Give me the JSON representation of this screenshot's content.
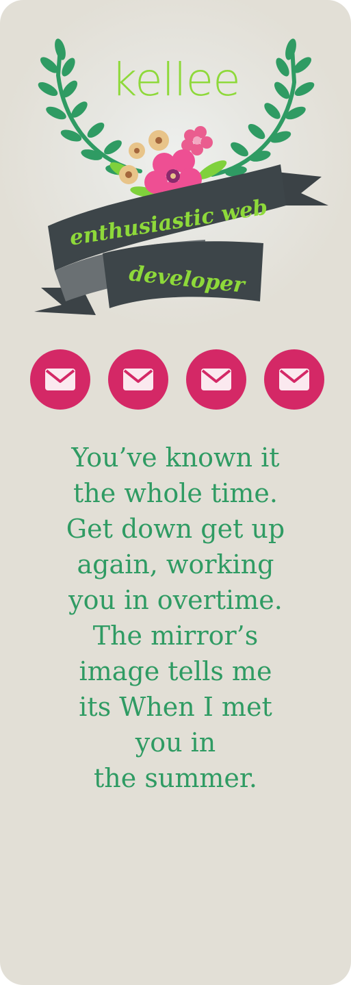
{
  "header": {
    "site_name": "kellee",
    "tagline_line1": "enthusiastic web",
    "tagline_line2": "developer",
    "decoration": [
      "laurel-wreath",
      "flower-bouquet",
      "ribbon-banner"
    ]
  },
  "social": {
    "buttons": [
      {
        "icon": "envelope-icon"
      },
      {
        "icon": "envelope-icon"
      },
      {
        "icon": "envelope-icon"
      },
      {
        "icon": "envelope-icon"
      }
    ]
  },
  "bio": {
    "lines": [
      "You’ve known it",
      "the whole time.",
      "Get down get up",
      "again, working",
      "you in overtime.",
      "The mirror’s",
      "image tells me",
      "its When I met",
      "you in",
      "the summer."
    ]
  },
  "colors": {
    "background": "#e2dfd6",
    "wreath": "#2f9b63",
    "accent_green": "#8ed93a",
    "button": "#d42866",
    "ribbon": "#3b4246",
    "text": "#2f9b63"
  }
}
